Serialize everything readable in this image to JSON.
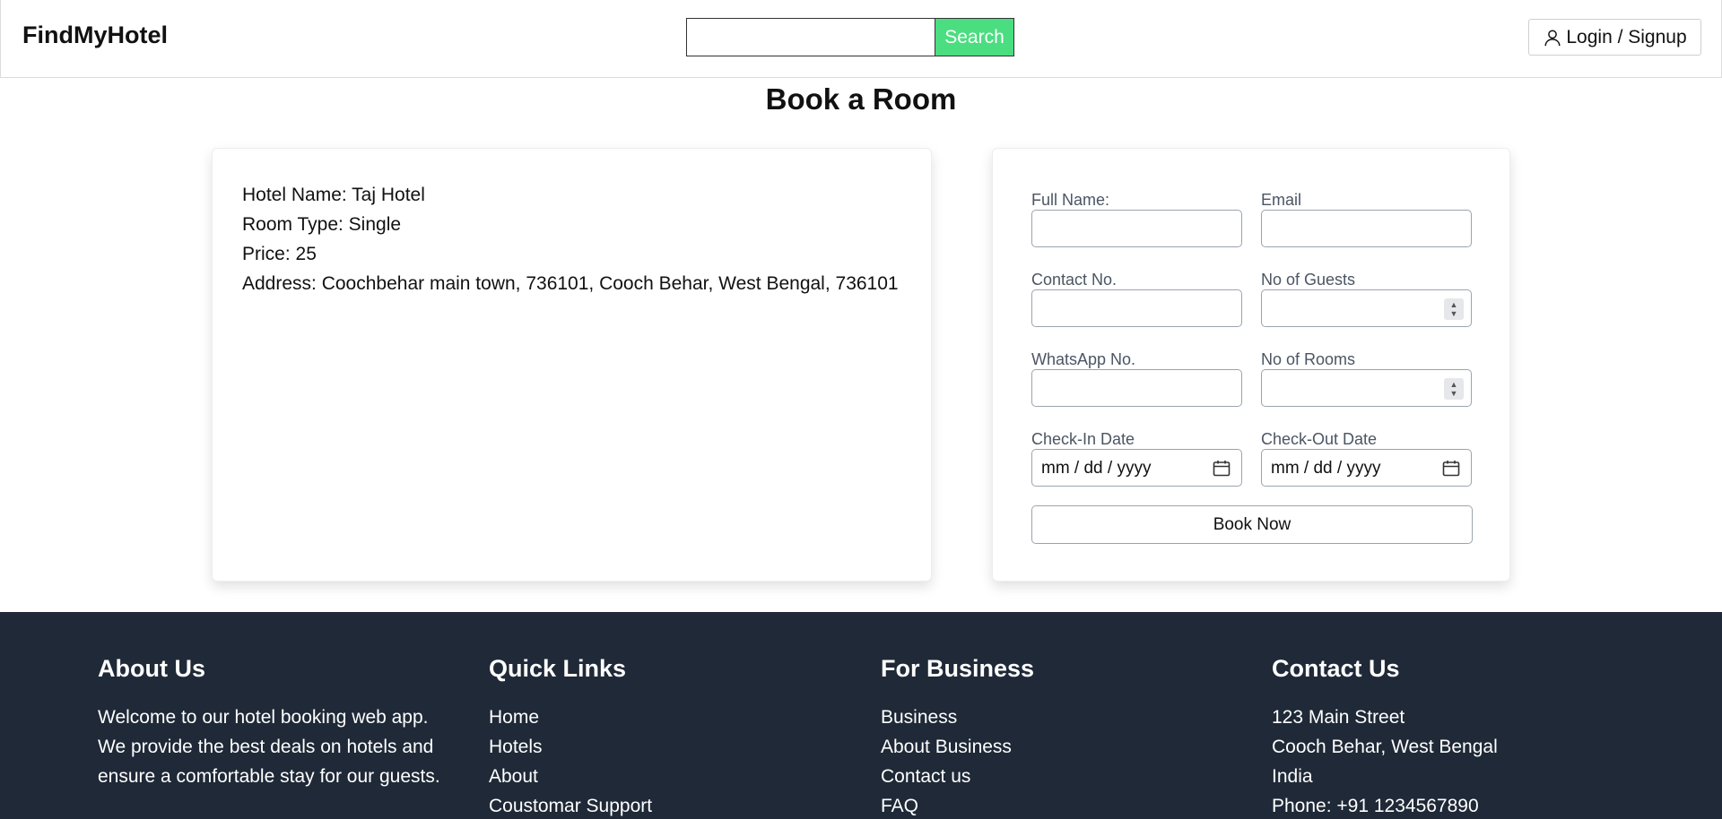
{
  "header": {
    "brand": "FindMyHotel",
    "search": {
      "value": "",
      "placeholder": "",
      "button_label": "Search"
    },
    "login_label": "Login / Signup"
  },
  "page_title": "Book a Room",
  "hotel_info": {
    "name_line": "Hotel Name: Taj Hotel",
    "room_type_line": "Room Type: Single",
    "price_line": "Price: 25",
    "address_line": "Address: Coochbehar main town, 736101, Cooch Behar, West Bengal, 736101"
  },
  "form": {
    "full_name_label": "Full Name:",
    "email_label": "Email",
    "contact_label": "Contact No.",
    "guests_label": "No of Guests",
    "whatsapp_label": "WhatsApp No.",
    "rooms_label": "No of Rooms",
    "checkin_label": "Check-In Date",
    "checkout_label": "Check-Out Date",
    "date_placeholder": "mm / dd / yyyy",
    "submit_label": "Book Now"
  },
  "footer": {
    "about": {
      "heading": "About Us",
      "text": "Welcome to our hotel booking web app. We provide the best deals on hotels and ensure a comfortable stay for our guests."
    },
    "quick_links": {
      "heading": "Quick Links",
      "items": [
        "Home",
        "Hotels",
        "About",
        "Coustomar Support"
      ]
    },
    "business": {
      "heading": "For Business",
      "items": [
        "Business",
        "About Business",
        "Contact us",
        "FAQ"
      ]
    },
    "contact": {
      "heading": "Contact Us",
      "lines": [
        "123 Main Street",
        "Cooch Behar, West Bengal",
        "India",
        "Phone: +91 1234567890"
      ]
    }
  },
  "colors": {
    "search_button": "#4ade80",
    "footer_bg": "#1f2937"
  }
}
